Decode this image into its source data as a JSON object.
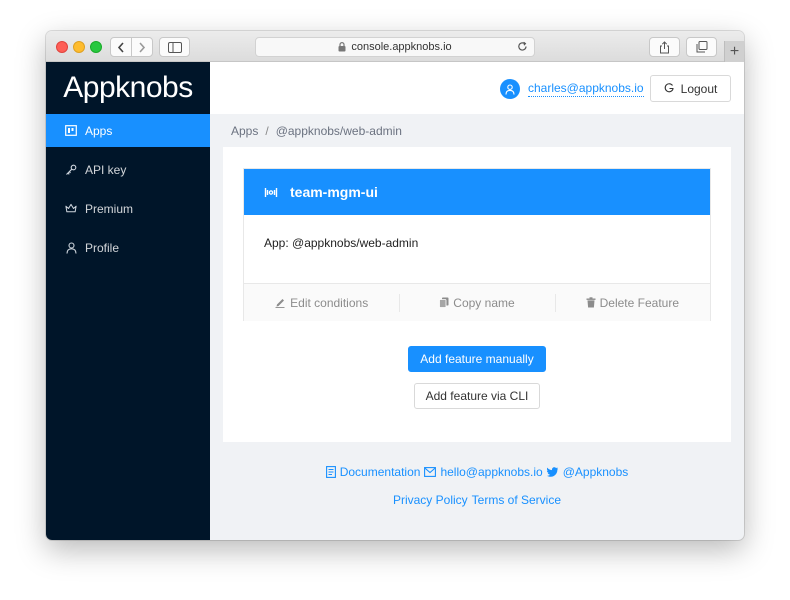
{
  "browser": {
    "url": "console.appknobs.io"
  },
  "sidebar": {
    "logo": "Appknobs",
    "items": [
      {
        "label": "Apps",
        "icon": "apps-icon",
        "active": true
      },
      {
        "label": "API key",
        "icon": "key-icon",
        "active": false
      },
      {
        "label": "Premium",
        "icon": "crown-icon",
        "active": false
      },
      {
        "label": "Profile",
        "icon": "user-icon",
        "active": false
      }
    ]
  },
  "header": {
    "user_email": "charles@appknobs.io",
    "logout_label": "Logout"
  },
  "breadcrumb": {
    "root": "Apps",
    "separator": "/",
    "current": "@appknobs/web-admin"
  },
  "feature_card": {
    "title": "team-mgm-ui",
    "body": "App: @appknobs/web-admin",
    "actions": {
      "edit": "Edit conditions",
      "copy": "Copy name",
      "delete": "Delete Feature"
    }
  },
  "buttons": {
    "add_manual": "Add feature manually",
    "add_cli": "Add feature via CLI"
  },
  "footer": {
    "documentation": "Documentation",
    "email": "hello@appknobs.io",
    "twitter": "@Appknobs",
    "privacy": "Privacy Policy",
    "terms": "Terms of Service"
  },
  "colors": {
    "primary": "#1890ff",
    "sidebar_bg": "#001529",
    "page_bg": "#f0f2f5"
  }
}
